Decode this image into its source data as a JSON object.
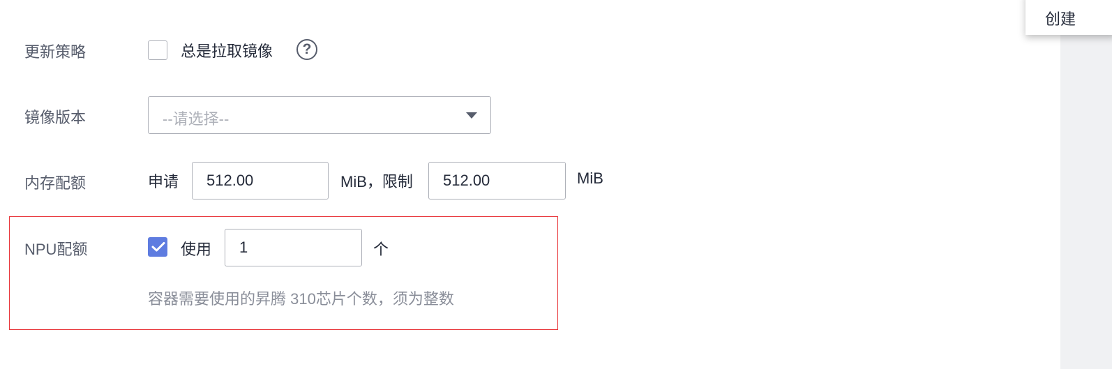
{
  "top_right": {
    "create_label": "创建"
  },
  "update_policy": {
    "label": "更新策略",
    "checkbox_label": "总是拉取镜像",
    "checked": false,
    "help_icon": "question-circle-icon"
  },
  "image_version": {
    "label": "镜像版本",
    "placeholder": "--请选择--",
    "caret_icon": "caret-down-icon"
  },
  "memory_quota": {
    "label": "内存配额",
    "request_prefix": "申请",
    "request_value": "512.00",
    "limit_prefix": "MiB，限制",
    "limit_value": "512.00",
    "limit_unit": "MiB"
  },
  "npu_quota": {
    "label": "NPU配额",
    "checkbox_label": "使用",
    "checked": true,
    "value": "1",
    "unit": "个",
    "hint": "容器需要使用的昇腾 310芯片个数，须为整数"
  },
  "colors": {
    "accent": "#5e7ce0",
    "highlight_border": "#e8363b"
  }
}
